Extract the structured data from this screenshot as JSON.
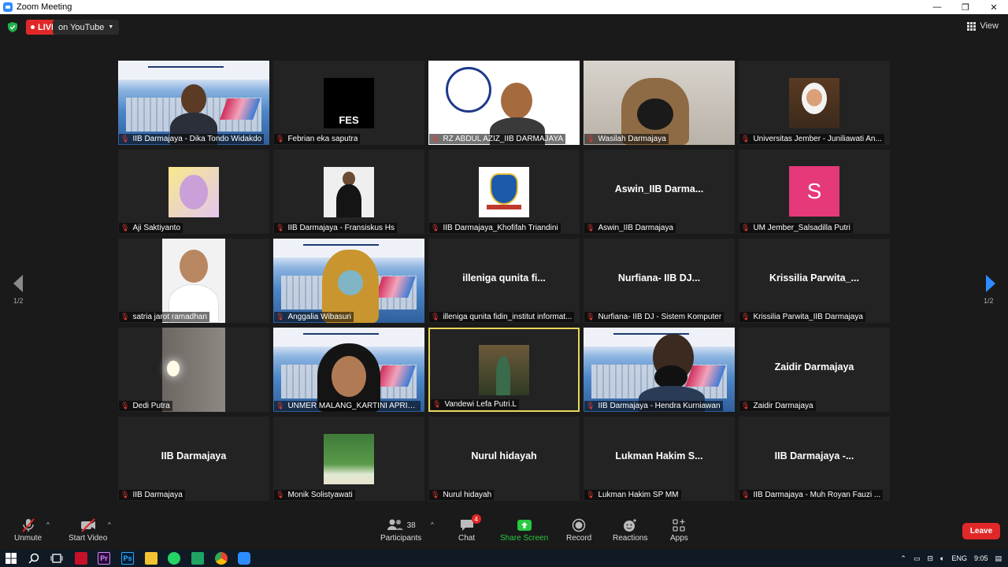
{
  "window": {
    "title": "Zoom Meeting",
    "controls": [
      "—",
      "❐",
      "✕"
    ]
  },
  "topbar": {
    "live_label": "LIVE",
    "stream_target": "on YouTube",
    "view_label": "View"
  },
  "tiles": [
    {
      "name": "IIB Darmajaya - Dika Tondo Widakdo",
      "kind": "video-banner-man"
    },
    {
      "name": "Febrian eka saputra",
      "kind": "fes-logo"
    },
    {
      "name": "RZ ABDUL AZIZ_IIB DARMAJAYA",
      "kind": "video-logo-man"
    },
    {
      "name": "Wasilah Darmajaya",
      "kind": "video-hijab"
    },
    {
      "name": "Universitas Jember - Juniliawati An...",
      "kind": "photo-hijab"
    },
    {
      "name": "Aji Saktiyanto",
      "kind": "photo-yellow"
    },
    {
      "name": "IIB Darmajaya - Fransiskus Hs",
      "kind": "photo-man-dark"
    },
    {
      "name": "IIB Darmajaya_Khofifah Triandini",
      "kind": "crest"
    },
    {
      "name": "Aswin_IIB Darmajaya",
      "kind": "text",
      "big": "Aswin_IIB  Darma..."
    },
    {
      "name": "UM Jember_Salsadilla Putri",
      "kind": "letter",
      "letter": "S"
    },
    {
      "name": "satria jarot ramadhan",
      "kind": "video-white-man"
    },
    {
      "name": "Anggalia Wibasuri",
      "kind": "video-banner-hijab"
    },
    {
      "name": "illeniga qunita fidin_institut informat...",
      "kind": "text",
      "big": "illeniga  qunita  fi..."
    },
    {
      "name": "Nurfiana- IIB DJ - Sistem Komputer",
      "kind": "text",
      "big": "Nurfiana-  IIB  DJ..."
    },
    {
      "name": "Krissilia Parwita_IIB Darmajaya",
      "kind": "text",
      "big": "Krissilia  Parwita_..."
    },
    {
      "name": "Dedi Putra",
      "kind": "video-dark-light"
    },
    {
      "name": "UNMER MALANG_KARTINI APRIANI",
      "kind": "video-banner-woman"
    },
    {
      "name": "Vandewi Lefa Putri.L",
      "kind": "photo-garden",
      "active": true
    },
    {
      "name": "IIB Darmajaya - Hendra Kurniawan",
      "kind": "video-banner-mask"
    },
    {
      "name": "Zaidir Darmajaya",
      "kind": "text",
      "big": "Zaidir  Darmajaya"
    },
    {
      "name": "IIB Darmajaya",
      "kind": "text",
      "big": "IIB  Darmajaya"
    },
    {
      "name": "Monik Solistyawati",
      "kind": "photo-group"
    },
    {
      "name": "Nurul hidayah",
      "kind": "text",
      "big": "Nurul  hidayah"
    },
    {
      "name": "Lukman Hakim SP MM",
      "kind": "text",
      "big": "Lukman  Hakim  S..."
    },
    {
      "name": "IIB Darmajaya - Muh Royan Fauzi ...",
      "kind": "text",
      "big": "IIB  Darmajaya  -..."
    }
  ],
  "pagination": {
    "left": "1/2",
    "right": "1/2"
  },
  "toolbar": {
    "unmute": "Unmute",
    "start_video": "Start Video",
    "participants": "Participants",
    "participants_count": "38",
    "chat": "Chat",
    "chat_badge": "4",
    "share_screen": "Share Screen",
    "record": "Record",
    "reactions": "Reactions",
    "apps": "Apps",
    "leave": "Leave"
  },
  "taskbar": {
    "lang": "ENG",
    "time": "9:05"
  },
  "colors": {
    "live": "#e02828",
    "share": "#28c840",
    "active_border": "#e6d85b",
    "avatar_s": "#e5397a"
  }
}
